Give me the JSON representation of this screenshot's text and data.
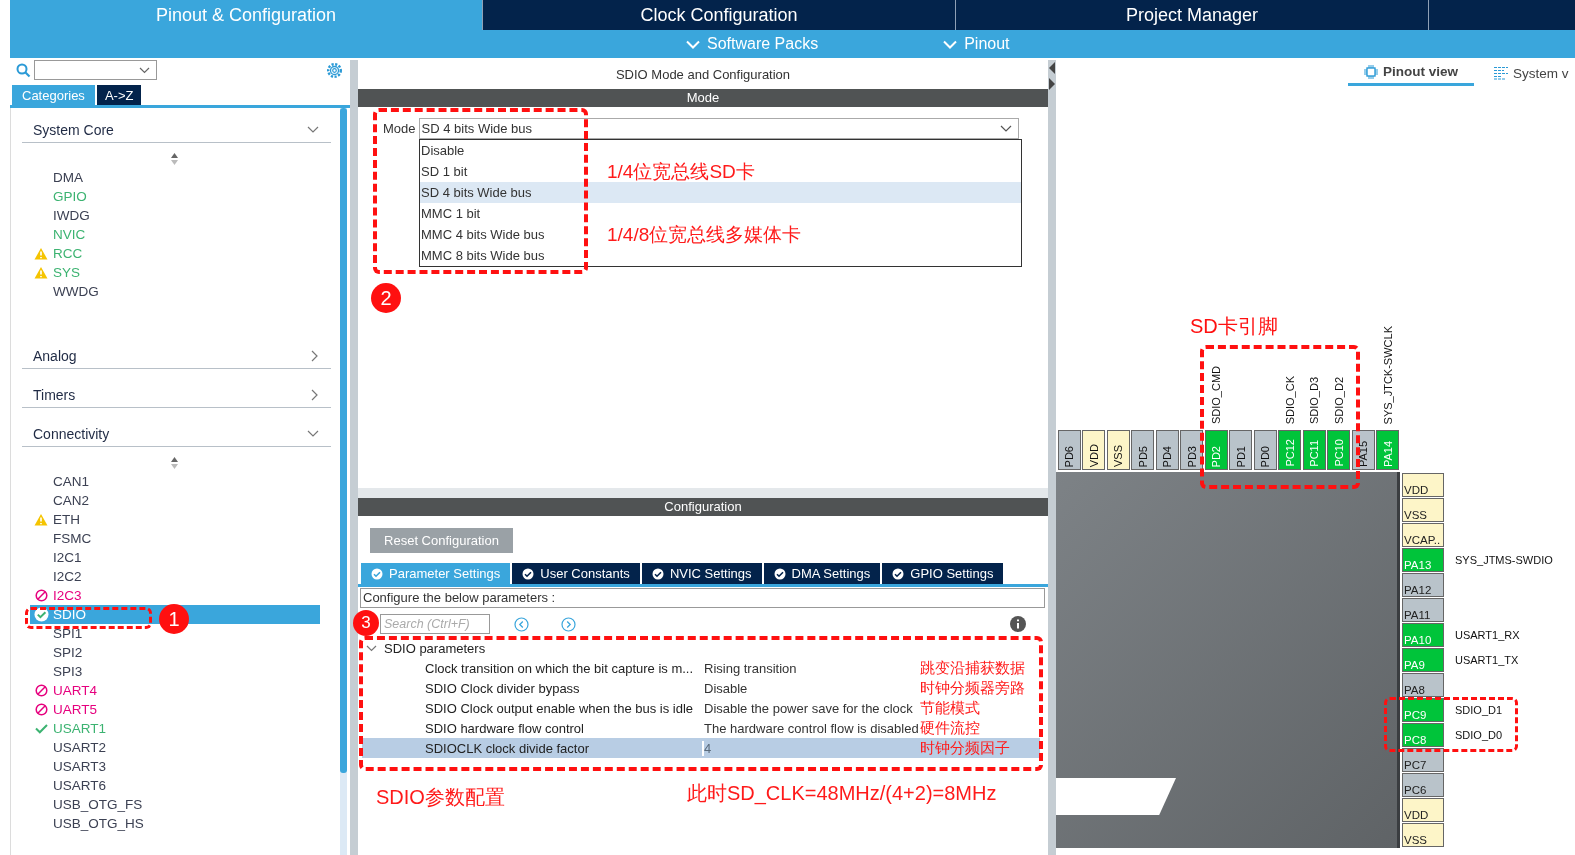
{
  "header": {
    "tabs": [
      {
        "label": "Pinout & Configuration",
        "selected": true
      },
      {
        "label": "Clock Configuration",
        "selected": false
      },
      {
        "label": "Project Manager",
        "selected": false
      }
    ],
    "menus": [
      "Software Packs",
      "Pinout"
    ]
  },
  "sidebar": {
    "tabs": [
      {
        "label": "Categories",
        "selected": true
      },
      {
        "label": "A->Z",
        "selected": false
      }
    ],
    "categories": [
      {
        "label": "System Core",
        "expanded": true,
        "items": [
          {
            "label": "DMA",
            "kind": "none",
            "color": "#3c4153",
            "selected": false
          },
          {
            "label": "GPIO",
            "kind": "none",
            "color": "#3cb371",
            "selected": false
          },
          {
            "label": "IWDG",
            "kind": "none",
            "color": "#3c4153",
            "selected": false
          },
          {
            "label": "NVIC",
            "kind": "none",
            "color": "#3cb371",
            "selected": false
          },
          {
            "label": "RCC",
            "kind": "warning",
            "color": "#3cb371",
            "selected": false
          },
          {
            "label": "SYS",
            "kind": "warning",
            "color": "#3cb371",
            "selected": false
          },
          {
            "label": "WWDG",
            "kind": "none",
            "color": "#3c4153",
            "selected": false
          }
        ]
      },
      {
        "label": "Analog",
        "expanded": false
      },
      {
        "label": "Timers",
        "expanded": false
      },
      {
        "label": "Connectivity",
        "expanded": true,
        "items": [
          {
            "label": "CAN1",
            "kind": "none",
            "color": "#3c4153",
            "selected": false
          },
          {
            "label": "CAN2",
            "kind": "none",
            "color": "#3c4153",
            "selected": false
          },
          {
            "label": "ETH",
            "kind": "warning",
            "color": "#3c4153",
            "selected": false
          },
          {
            "label": "FSMC",
            "kind": "none",
            "color": "#3c4153",
            "selected": false
          },
          {
            "label": "I2C1",
            "kind": "none",
            "color": "#3c4153",
            "selected": false
          },
          {
            "label": "I2C2",
            "kind": "none",
            "color": "#3c4153",
            "selected": false
          },
          {
            "label": "I2C3",
            "kind": "blocked",
            "color": "#e6007e",
            "selected": false
          },
          {
            "label": "SDIO",
            "kind": "ok",
            "color": "#3cb371",
            "selected": true
          },
          {
            "label": "SPI1",
            "kind": "none",
            "color": "#3c4153",
            "selected": false
          },
          {
            "label": "SPI2",
            "kind": "none",
            "color": "#3c4153",
            "selected": false
          },
          {
            "label": "SPI3",
            "kind": "none",
            "color": "#3c4153",
            "selected": false
          },
          {
            "label": "UART4",
            "kind": "blocked",
            "color": "#e6007e",
            "selected": false
          },
          {
            "label": "UART5",
            "kind": "blocked",
            "color": "#e6007e",
            "selected": false
          },
          {
            "label": "USART1",
            "kind": "ok",
            "color": "#3cb371",
            "selected": false
          },
          {
            "label": "USART2",
            "kind": "none",
            "color": "#3c4153",
            "selected": false
          },
          {
            "label": "USART3",
            "kind": "none",
            "color": "#3c4153",
            "selected": false
          },
          {
            "label": "USART6",
            "kind": "none",
            "color": "#3c4153",
            "selected": false
          },
          {
            "label": "USB_OTG_FS",
            "kind": "none",
            "color": "#3c4153",
            "selected": false
          },
          {
            "label": "USB_OTG_HS",
            "kind": "none",
            "color": "#3c4153",
            "selected": false
          }
        ]
      }
    ]
  },
  "mode_panel": {
    "title": "SDIO Mode and Configuration",
    "header": "Mode",
    "mode_label": "Mode",
    "mode_value": "SD 4 bits Wide bus",
    "options": [
      {
        "label": "Disable",
        "selected": false
      },
      {
        "label": "SD 1 bit",
        "selected": false,
        "note": "1/4位宽总线SD卡"
      },
      {
        "label": "SD 4 bits Wide bus",
        "selected": true
      },
      {
        "label": "MMC 1 bit",
        "selected": false
      },
      {
        "label": "MMC 4 bits Wide bus",
        "selected": false,
        "note": "1/4/8位宽总线多媒体卡"
      },
      {
        "label": "MMC 8 bits Wide bus",
        "selected": false
      }
    ]
  },
  "configuration": {
    "header": "Configuration",
    "reset_button": "Reset Configuration",
    "tabs": [
      {
        "label": "Parameter Settings",
        "selected": true
      },
      {
        "label": "User Constants",
        "selected": false
      },
      {
        "label": "NVIC Settings",
        "selected": false
      },
      {
        "label": "DMA Settings",
        "selected": false
      },
      {
        "label": "GPIO Settings",
        "selected": false
      }
    ],
    "hint": "Configure the below parameters :",
    "search_placeholder": "Search (Ctrl+F)",
    "group": {
      "label": "SDIO parameters",
      "expanded": true,
      "rows": [
        {
          "name": "Clock transition on which the bit capture is m...",
          "value": "Rising transition",
          "note": "跳变沿捕获数据",
          "selected": false
        },
        {
          "name": "SDIO Clock divider bypass",
          "value": "Disable",
          "note": "时钟分频器旁路",
          "selected": false
        },
        {
          "name": "SDIO Clock output enable when the bus is idle",
          "value": "Disable the power save for the clock",
          "note": "节能模式",
          "selected": false
        },
        {
          "name": "SDIO hardware flow control",
          "value": "The hardware control flow is disabled",
          "note": "硬件流控",
          "selected": false
        },
        {
          "name": "SDIOCLK clock divide factor",
          "value": "4",
          "note": "时钟分频因子",
          "selected": true
        }
      ]
    },
    "notes": [
      "SDIO参数配置",
      "此时SD_CLK=48MHz/(4+2)=8MHz"
    ]
  },
  "pinout": {
    "view_tabs": [
      {
        "label": "Pinout view",
        "selected": true
      },
      {
        "label": "System v",
        "selected": false
      }
    ],
    "top_pins": [
      {
        "name": "PD6",
        "kind": "io"
      },
      {
        "name": "VDD",
        "kind": "power"
      },
      {
        "name": "VSS",
        "kind": "power"
      },
      {
        "name": "PD5",
        "kind": "io"
      },
      {
        "name": "PD4",
        "kind": "io"
      },
      {
        "name": "PD3",
        "kind": "io"
      },
      {
        "name": "PD2",
        "kind": "assigned",
        "signal": "SDIO_CMD"
      },
      {
        "name": "PD1",
        "kind": "io"
      },
      {
        "name": "PD0",
        "kind": "io"
      },
      {
        "name": "PC12",
        "kind": "assigned",
        "signal": "SDIO_CK"
      },
      {
        "name": "PC11",
        "kind": "assigned",
        "signal": "SDIO_D3"
      },
      {
        "name": "PC10",
        "kind": "assigned",
        "signal": "SDIO_D2"
      },
      {
        "name": "PA15",
        "kind": "io"
      },
      {
        "name": "PA14",
        "kind": "assigned",
        "signal": "SYS_JTCK-SWCLK"
      }
    ],
    "right_pins": [
      {
        "name": "VDD",
        "kind": "power"
      },
      {
        "name": "VSS",
        "kind": "power"
      },
      {
        "name": "VCAP..",
        "kind": "power"
      },
      {
        "name": "PA13",
        "kind": "assigned",
        "signal": "SYS_JTMS-SWDIO"
      },
      {
        "name": "PA12",
        "kind": "io"
      },
      {
        "name": "PA11",
        "kind": "io"
      },
      {
        "name": "PA10",
        "kind": "assigned",
        "signal": "USART1_RX"
      },
      {
        "name": "PA9",
        "kind": "assigned",
        "signal": "USART1_TX"
      },
      {
        "name": "PA8",
        "kind": "io"
      },
      {
        "name": "PC9",
        "kind": "assigned",
        "signal": "SDIO_D1"
      },
      {
        "name": "PC8",
        "kind": "assigned",
        "signal": "SDIO_D0"
      },
      {
        "name": "PC7",
        "kind": "io"
      },
      {
        "name": "PC6",
        "kind": "io"
      },
      {
        "name": "VDD",
        "kind": "power"
      },
      {
        "name": "VSS",
        "kind": "power"
      }
    ]
  },
  "annotations": {
    "badges": [
      "1",
      "2",
      "3"
    ],
    "pin_callout": "SD卡引脚"
  }
}
